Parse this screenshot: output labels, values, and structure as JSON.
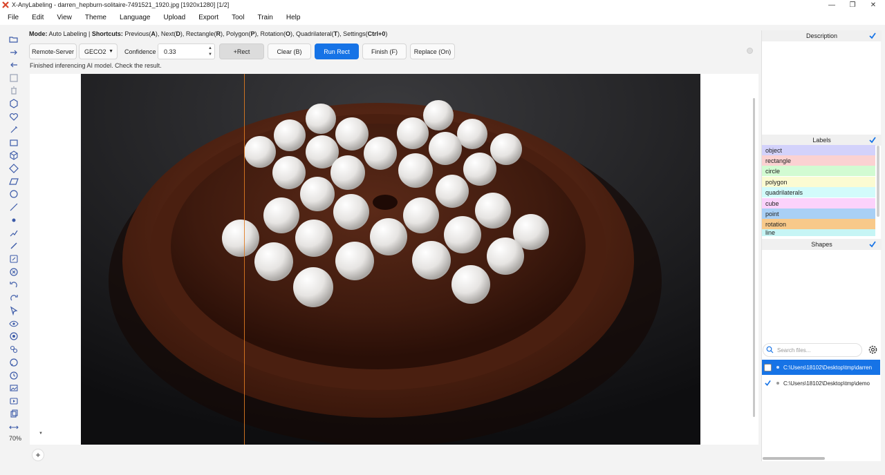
{
  "window": {
    "title": "X-AnyLabeling - darren_hepburn-solitaire-7491521_1920.jpg [1920x1280] [1/2]",
    "controls": [
      "—",
      "❐",
      "✕"
    ]
  },
  "menu": [
    "File",
    "Edit",
    "View",
    "Theme",
    "Language",
    "Upload",
    "Export",
    "Tool",
    "Train",
    "Help"
  ],
  "mode_line": {
    "mode_label": "Mode:",
    "mode_value": " Auto Labeling | ",
    "shortcuts_label": "Shortcuts:",
    "s1": " Previous(",
    "k1": "A",
    "s2": "), Next(",
    "k2": "D",
    "s3": "), Rectangle(",
    "k3": "R",
    "s4": "), Polygon(",
    "k4": "P",
    "s5": "), Rotation(",
    "k5": "O",
    "s6": "), Quadrilateral(",
    "k6": "T",
    "s7": "), Settings(",
    "k7": "Ctrl+0",
    "s8": ")"
  },
  "controls": {
    "server": "Remote-Server",
    "model": "GECO2",
    "confidence_label": "Confidence",
    "confidence_value": "0.33",
    "add_rect": "+Rect",
    "clear": "Clear (B)",
    "run_rect": "Run Rect",
    "finish": "Finish (F)",
    "replace": "Replace (On)"
  },
  "status": "Finished inferencing AI model. Check the result.",
  "zoom": "70%",
  "panels": {
    "description": "Description",
    "labels": "Labels",
    "shapes": "Shapes"
  },
  "labels": [
    {
      "name": "object",
      "color": "#d3d2fb"
    },
    {
      "name": "rectangle",
      "color": "#fbd2d2"
    },
    {
      "name": "circle",
      "color": "#d2fbd2"
    },
    {
      "name": "polygon",
      "color": "#fbfbd2"
    },
    {
      "name": "quadrilaterals",
      "color": "#d2fbfb"
    },
    {
      "name": "cube",
      "color": "#fbd2fb"
    },
    {
      "name": "point",
      "color": "#a9d0f5"
    },
    {
      "name": "rotation",
      "color": "#f8c98a"
    },
    {
      "name": "line",
      "color": "#c6f5f5"
    }
  ],
  "search": {
    "placeholder": "Search files..."
  },
  "files": [
    {
      "path": "C:\\Users\\18102\\Desktop\\tmp\\darren",
      "checked": false,
      "selected": true
    },
    {
      "path": "C:\\Users\\18102\\Desktop\\tmp\\demo",
      "checked": true,
      "selected": false
    }
  ],
  "accent": "#1673e6",
  "icons": [
    "open-folder-icon",
    "next-icon",
    "prev-icon",
    "save-icon",
    "delete-icon",
    "polygon-icon",
    "heart-icon",
    "magic-icon",
    "rectangle-icon",
    "cube-icon",
    "diamond-icon",
    "quad-icon",
    "circle-icon",
    "line-icon",
    "point-icon",
    "linestrip-icon",
    "brush-icon",
    "edit-icon",
    "cancel-icon",
    "undo-icon",
    "redo-icon",
    "cursor-icon",
    "eye-icon",
    "target-icon",
    "group-icon",
    "chat-icon",
    "clock-icon",
    "image-icon",
    "video-icon",
    "copy-icon",
    "fit-width-icon"
  ]
}
